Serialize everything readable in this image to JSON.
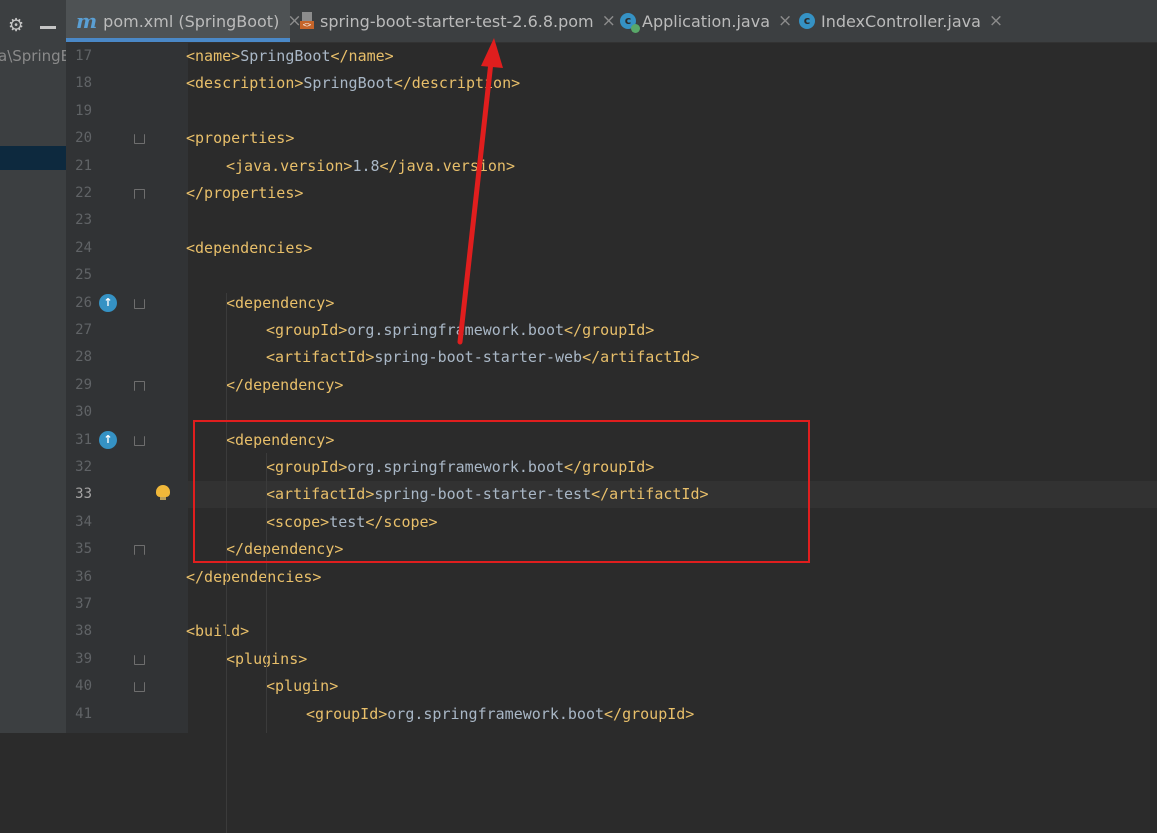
{
  "left_panel": {
    "path_text": "a\\SpringB",
    "gear_icon": "gear-icon",
    "minimize_icon": "minus-icon"
  },
  "tabs": [
    {
      "label": "pom.xml (SpringBoot)",
      "icon": "maven-icon",
      "active": true
    },
    {
      "label": "spring-boot-starter-test-2.6.8.pom",
      "icon": "pom-file-icon",
      "active": false
    },
    {
      "label": "Application.java",
      "icon": "java-class-run-icon",
      "active": false
    },
    {
      "label": "IndexController.java",
      "icon": "java-class-icon",
      "active": false
    }
  ],
  "tab_close_glyph": "×",
  "editor": {
    "current_line": 33,
    "lines": [
      {
        "n": "17",
        "parts": [
          [
            "t",
            "<name>"
          ],
          [
            "x",
            "SpringBoot"
          ],
          [
            "t",
            "</name>"
          ]
        ],
        "indent": 1
      },
      {
        "n": "18",
        "parts": [
          [
            "t",
            "<description>"
          ],
          [
            "x",
            "SpringBoot"
          ],
          [
            "t",
            "</description>"
          ]
        ],
        "indent": 1
      },
      {
        "n": "19",
        "parts": [],
        "indent": 0
      },
      {
        "n": "20",
        "parts": [
          [
            "t",
            "<properties>"
          ]
        ],
        "indent": 1
      },
      {
        "n": "21",
        "parts": [
          [
            "t",
            "<java.version>"
          ],
          [
            "x",
            "1.8"
          ],
          [
            "t",
            "</java.version>"
          ]
        ],
        "indent": 2
      },
      {
        "n": "22",
        "parts": [
          [
            "t",
            "</properties>"
          ]
        ],
        "indent": 1
      },
      {
        "n": "23",
        "parts": [],
        "indent": 0
      },
      {
        "n": "24",
        "parts": [
          [
            "t",
            "<dependencies>"
          ]
        ],
        "indent": 1
      },
      {
        "n": "25",
        "parts": [],
        "indent": 0
      },
      {
        "n": "26",
        "parts": [
          [
            "t",
            "<dependency>"
          ]
        ],
        "indent": 2
      },
      {
        "n": "27",
        "parts": [
          [
            "t",
            "<groupId>"
          ],
          [
            "x",
            "org.springframework.boot"
          ],
          [
            "t",
            "</groupId>"
          ]
        ],
        "indent": 3
      },
      {
        "n": "28",
        "parts": [
          [
            "t",
            "<artifactId>"
          ],
          [
            "x",
            "spring-boot-starter-web"
          ],
          [
            "t",
            "</artifactId>"
          ]
        ],
        "indent": 3
      },
      {
        "n": "29",
        "parts": [
          [
            "t",
            "</dependency>"
          ]
        ],
        "indent": 2
      },
      {
        "n": "30",
        "parts": [],
        "indent": 0
      },
      {
        "n": "31",
        "parts": [
          [
            "t",
            "<dependency>"
          ]
        ],
        "indent": 2
      },
      {
        "n": "32",
        "parts": [
          [
            "t",
            "<groupId>"
          ],
          [
            "x",
            "org.springframework.boot"
          ],
          [
            "t",
            "</groupId>"
          ]
        ],
        "indent": 3
      },
      {
        "n": "33",
        "parts": [
          [
            "t",
            "<artifactId>"
          ],
          [
            "x",
            "spring-boot-starter-test"
          ],
          [
            "t",
            "</artifactId>"
          ]
        ],
        "indent": 3
      },
      {
        "n": "34",
        "parts": [
          [
            "t",
            "<scope>"
          ],
          [
            "x",
            "test"
          ],
          [
            "t",
            "</scope>"
          ]
        ],
        "indent": 3
      },
      {
        "n": "35",
        "parts": [
          [
            "t",
            "</dependency>"
          ]
        ],
        "indent": 2
      },
      {
        "n": "36",
        "parts": [
          [
            "t",
            "</dependencies>"
          ]
        ],
        "indent": 1
      },
      {
        "n": "37",
        "parts": [],
        "indent": 0
      },
      {
        "n": "38",
        "parts": [
          [
            "t",
            "<build>"
          ]
        ],
        "indent": 1
      },
      {
        "n": "39",
        "parts": [
          [
            "t",
            "<plugins>"
          ]
        ],
        "indent": 2
      },
      {
        "n": "40",
        "parts": [
          [
            "t",
            "<plugin>"
          ]
        ],
        "indent": 3
      },
      {
        "n": "41",
        "parts": [
          [
            "t",
            "<groupId>"
          ],
          [
            "x",
            "org.springframework.boot"
          ],
          [
            "t",
            "</groupId>"
          ]
        ],
        "indent": 4
      }
    ],
    "fold_open_lines": [
      "20",
      "26",
      "31",
      "39",
      "40"
    ],
    "fold_close_lines": [
      "22",
      "29",
      "35"
    ],
    "up_icon_lines": [
      "26",
      "31"
    ],
    "bulb_line": "33"
  },
  "colors": {
    "tag": "#e8bf6a",
    "text": "#a9b7c6",
    "annotation": "#e01e1e",
    "tab_underline": "#4a88c7"
  },
  "annotations": {
    "highlight_box": "red-rectangle",
    "arrow": "red-arrow"
  }
}
